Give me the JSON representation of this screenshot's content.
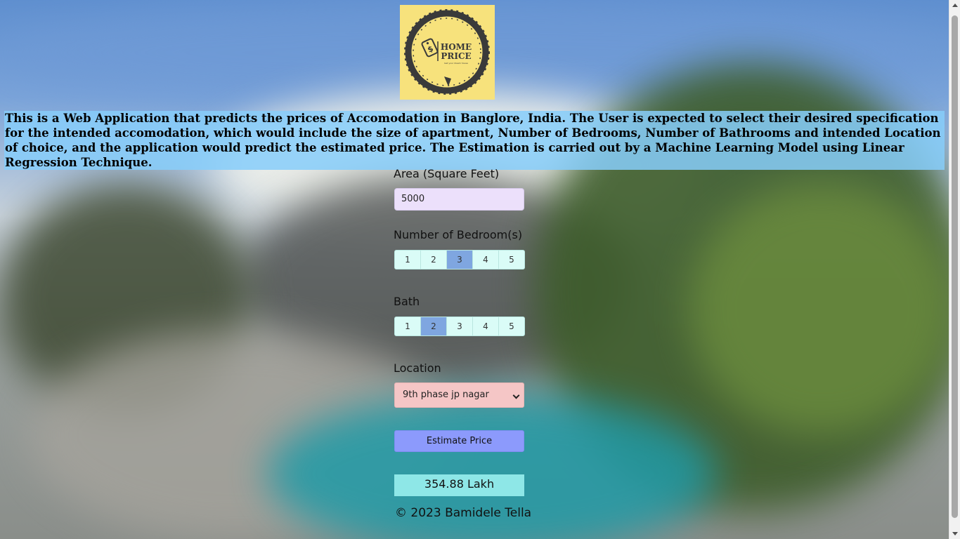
{
  "logo": {
    "line1": "HOME",
    "line2": "PRICE",
    "tagline": "Get your dream house",
    "bg_color": "#f7e27c"
  },
  "description": "This is a Web Application that predicts the prices of Accomodation in Banglore, India. The User is expected to select their desired specification for the intended accomodation, which would include the size of apartment, Number of Bedrooms, Number of Bathrooms and intended Location of choice, and the application would predict the estimated price. The Estimation is carried out by a Machine Learning Model using Linear Regression Technique.",
  "form": {
    "area_label": "Area (Square Feet)",
    "area_value": "5000",
    "bedrooms_label": "Number of Bedroom(s)",
    "bedroom_options": [
      "1",
      "2",
      "3",
      "4",
      "5"
    ],
    "bedrooms_selected": "3",
    "bath_label": "Bath",
    "bath_options": [
      "1",
      "2",
      "3",
      "4",
      "5"
    ],
    "bath_selected": "2",
    "location_label": "Location",
    "location_value": "9th phase jp nagar",
    "estimate_button": "Estimate Price",
    "result": "354.88 Lakh"
  },
  "footer": "© 2023 Bamidele Tella",
  "colors": {
    "description_bg": "#87cefa",
    "area_input_bg": "#ece0fb",
    "segment_bg": "#dafcf7",
    "segment_active": "#7fa6e0",
    "select_bg": "#f5c6c6",
    "button_bg": "#8c9afc",
    "result_bg": "#8ee7e7"
  }
}
